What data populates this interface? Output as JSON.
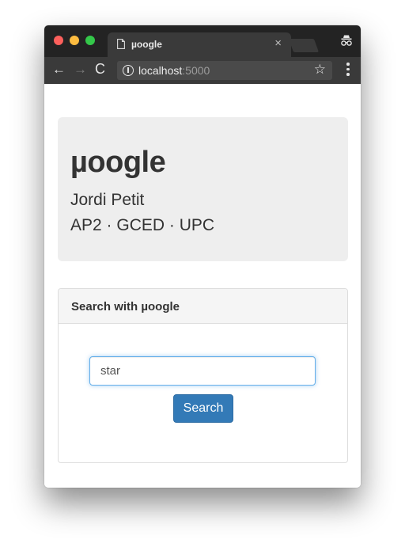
{
  "browser": {
    "tab_title": "µoogle",
    "tab_close": "×",
    "url_host": "localhost",
    "url_port": ":5000",
    "back_glyph": "←",
    "forward_glyph": "→",
    "reload_glyph": "C",
    "star_glyph": "☆",
    "icons": [
      "file-icon",
      "close-icon",
      "incognito-icon",
      "back-icon",
      "forward-icon",
      "reload-icon",
      "info-icon",
      "bookmark-star-icon",
      "menu-icon"
    ]
  },
  "jumbotron": {
    "title": "µoogle",
    "author": "Jordi Petit",
    "course": "AP2 · GCED · UPC"
  },
  "search_panel": {
    "heading": "Search with µoogle",
    "query_value": "star",
    "button_label": "Search"
  },
  "colors": {
    "primary_button": "#337ab7",
    "input_focus": "#66afe9",
    "jumbotron_bg": "#eeeeee",
    "browser_chrome": "#3a3a3a"
  }
}
